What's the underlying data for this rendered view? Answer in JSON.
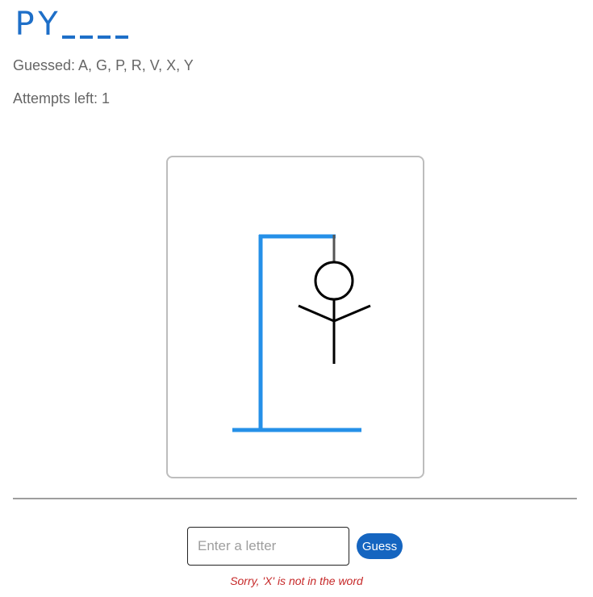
{
  "word": {
    "letters": [
      "P",
      "Y",
      "",
      "",
      "",
      ""
    ]
  },
  "status": {
    "guessed": "Guessed: A, G, P, R, V, X, Y",
    "attempts": "Attempts left: 1"
  },
  "input": {
    "placeholder": "Enter a letter",
    "value": ""
  },
  "guess_button": {
    "label": "Guess"
  },
  "feedback": {
    "message": "Sorry, 'X' is not in the word"
  },
  "colors": {
    "word": "#1e6fc8",
    "gallows": "#2590e8",
    "rope": "#555555",
    "figure": "#000000",
    "button": "#1565c0",
    "feedback": "#c62828"
  },
  "icons": {
    "hangman": "hangman-drawing"
  }
}
